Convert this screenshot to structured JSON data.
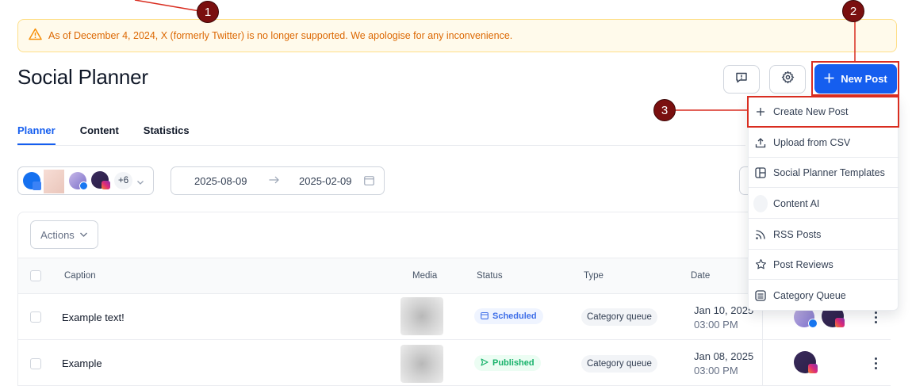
{
  "banner": {
    "text": "As of December 4, 2024, X (formerly Twitter) is no longer supported. We apologise for any inconvenience.",
    "icon": "warning-triangle-icon"
  },
  "header": {
    "title": "Social Planner",
    "new_post_label": "New Post"
  },
  "tabs": [
    {
      "label": "Planner"
    },
    {
      "label": "Content"
    },
    {
      "label": "Statistics"
    }
  ],
  "filters": {
    "account_overflow": "+6",
    "date_start": "2025-08-09",
    "date_end": "2025-02-09"
  },
  "actions_label": "Actions",
  "table": {
    "columns": [
      "Caption",
      "Media",
      "Status",
      "Type",
      "Date"
    ],
    "rows": [
      {
        "caption": "Example text!",
        "status": "Scheduled",
        "type": "Category queue",
        "date": "Jan 10, 2025",
        "time": "03:00 PM"
      },
      {
        "caption": "Example",
        "status": "Published",
        "type": "Category queue",
        "date": "Jan 08, 2025",
        "time": "03:00 PM"
      }
    ]
  },
  "dropdown": {
    "items": [
      {
        "label": "Create New Post",
        "icon": "plus-icon"
      },
      {
        "label": "Upload from CSV",
        "icon": "upload-icon"
      },
      {
        "label": "Social Planner Templates",
        "icon": "template-icon"
      },
      {
        "label": "Content AI",
        "icon": "ai-icon"
      },
      {
        "label": "RSS Posts",
        "icon": "rss-icon"
      },
      {
        "label": "Post Reviews",
        "icon": "star-icon"
      },
      {
        "label": "Category Queue",
        "icon": "queue-icon"
      }
    ]
  },
  "annotations": {
    "one": "1",
    "two": "2",
    "three": "3"
  },
  "colors": {
    "primary": "#155eef",
    "warning": "#dc6803",
    "annotation": "#d92d20",
    "badge": "#7a0f0f"
  }
}
